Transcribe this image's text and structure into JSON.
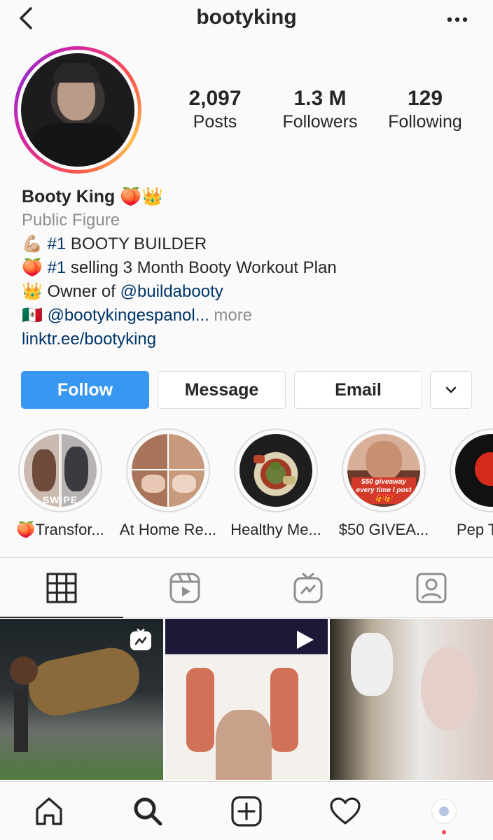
{
  "header": {
    "username": "bootyking"
  },
  "stats": [
    {
      "value": "2,097",
      "label": "Posts"
    },
    {
      "value": "1.3 M",
      "label": "Followers"
    },
    {
      "value": "129",
      "label": "Following"
    }
  ],
  "bio": {
    "name": "Booty King 🍑👑",
    "category": "Public Figure",
    "line1_emoji": "💪🏼",
    "line1_tag": "#1",
    "line1_text": " BOOTY BUILDER",
    "line2_emoji": "🍑",
    "line2_tag": "#1",
    "line2_text": " selling 3 Month Booty Workout Plan",
    "line3_emoji": "👑",
    "line3_text": " Owner of ",
    "line3_mention": "@buildabooty",
    "line4_emoji": "🇲🇽",
    "line4_mention": "@bootykingespanol...",
    "line4_more": " more",
    "link": "linktr.ee/bootyking"
  },
  "buttons": {
    "follow": "Follow",
    "message": "Message",
    "email": "Email"
  },
  "highlights": [
    {
      "label": "🍑Transfor...",
      "overlay": "SWIPE"
    },
    {
      "label": "At Home Re..."
    },
    {
      "label": "Healthy Me..."
    },
    {
      "label": "$50 GIVEA...",
      "overlay": "$50 giveaway every time I post 🎁🎁"
    },
    {
      "label": "Pep T"
    }
  ],
  "colors": {
    "accent": "#3897f0",
    "link": "#003569",
    "muted": "#8e8e8e"
  }
}
